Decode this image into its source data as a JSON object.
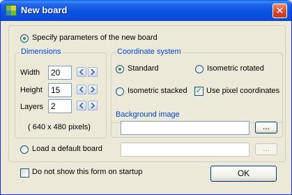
{
  "window": {
    "title": "New board",
    "close_label": "✕"
  },
  "specify": {
    "label": "Specify parameters of the new board",
    "checked": true
  },
  "dimensions": {
    "legend": "Dimensions",
    "width_label": "Width",
    "width_value": "20",
    "height_label": "Height",
    "height_value": "15",
    "layers_label": "Layers",
    "layers_value": "2",
    "pixels_text": "( 640 x  480 pixels)"
  },
  "coordinate_system": {
    "legend": "Coordinate system",
    "standard_label": "Standard",
    "isometric_rotated_label": "Isometric rotated",
    "isometric_stacked_label": "Isometric stacked",
    "use_pixel_label": "Use pixel coordinates",
    "selected": "Standard",
    "use_pixel_checked": true
  },
  "background_image": {
    "legend": "Background image",
    "value": "",
    "browse_label": "..."
  },
  "load_default": {
    "label": "Load a default board",
    "value": "",
    "browse_label": "...",
    "checked": false
  },
  "startup": {
    "label": "Do not show this form on startup",
    "checked": false
  },
  "ok_label": "OK",
  "colors": {
    "title_bar": "#0a53e3",
    "group_legend": "#0046d5",
    "window_bg": "#ece9d8"
  }
}
